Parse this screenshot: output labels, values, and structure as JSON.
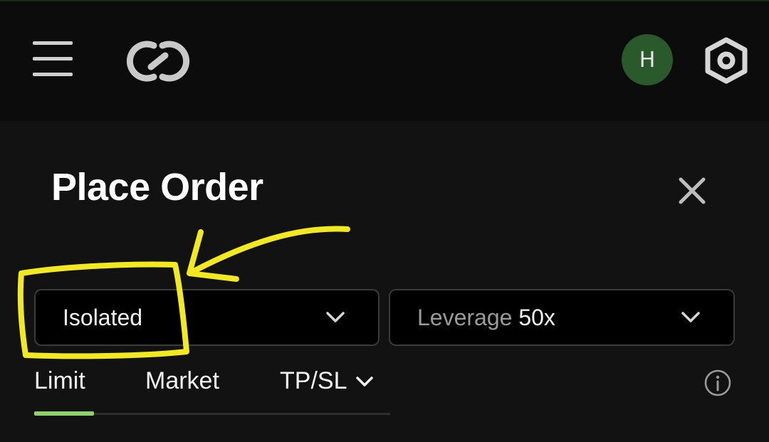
{
  "header": {
    "avatar_initial": "H",
    "icons": {
      "menu": "hamburger-menu-icon",
      "logo": "brand-logo",
      "settings": "hexagon-settings-icon"
    }
  },
  "order_panel": {
    "title": "Place Order",
    "close_icon": "close-icon",
    "margin_mode": {
      "value": "Isolated",
      "icon": "chevron-down-icon"
    },
    "leverage": {
      "label": "Leverage",
      "value": "50x",
      "icon": "chevron-down-icon"
    },
    "tabs": [
      {
        "label": "Limit",
        "active": true
      },
      {
        "label": "Market",
        "active": false
      },
      {
        "label": "TP/SL",
        "active": false,
        "dropdown": true
      }
    ],
    "info_icon": "info-circle-icon"
  },
  "colors": {
    "background": "#121212",
    "header_bg": "#0c0c0c",
    "avatar_bg": "#2a5a2c",
    "active_tab_indicator": "#8fd16a",
    "annotation": "#f2ea1e"
  }
}
